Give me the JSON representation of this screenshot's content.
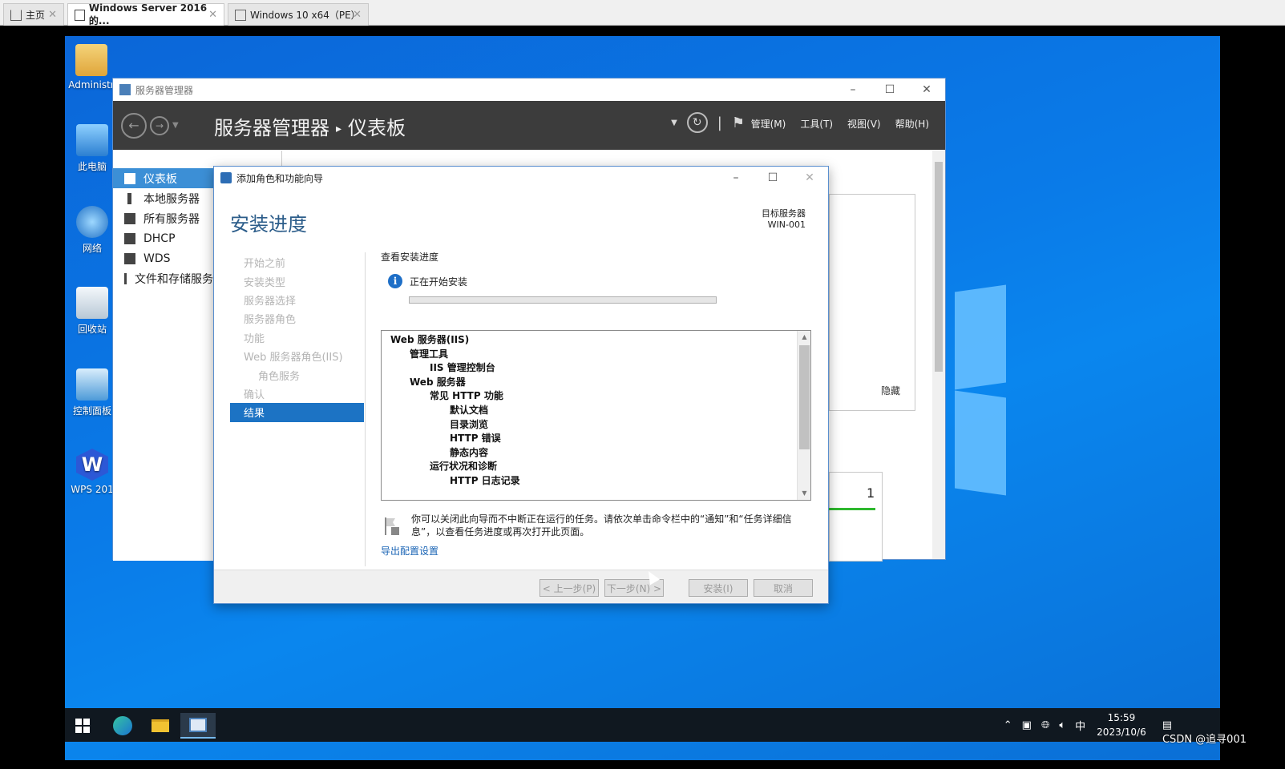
{
  "host_tabs": [
    {
      "label": "主页",
      "active": false
    },
    {
      "label": "Windows Server 2016 的...",
      "active": true
    },
    {
      "label": "Windows 10 x64（PE）",
      "active": false
    }
  ],
  "desktop": {
    "icons": [
      {
        "label": "Administr",
        "icon": "user-folder-icon"
      },
      {
        "label": "此电脑",
        "icon": "computer-icon"
      },
      {
        "label": "网络",
        "icon": "network-icon"
      },
      {
        "label": "回收站",
        "icon": "recycle-bin-icon"
      },
      {
        "label": "控制面板",
        "icon": "control-panel-icon"
      },
      {
        "label": "WPS 201",
        "icon": "wps-icon"
      }
    ]
  },
  "server_manager": {
    "window_title": "服务器管理器",
    "crumb_root": "服务器管理器",
    "crumb_page": "仪表板",
    "menus": [
      "管理(M)",
      "工具(T)",
      "视图(V)",
      "帮助(H)"
    ],
    "sidebar": [
      {
        "label": "仪表板",
        "active": true
      },
      {
        "label": "本地服务器",
        "active": false
      },
      {
        "label": "所有服务器",
        "active": false
      },
      {
        "label": "DHCP",
        "active": false
      },
      {
        "label": "WDS",
        "active": false
      },
      {
        "label": "文件和存储服务",
        "active": false
      }
    ],
    "hide_label": "隐藏",
    "tile_count": "1"
  },
  "wizard": {
    "title": "添加角色和功能向导",
    "heading": "安装进度",
    "target_label": "目标服务器",
    "target_name": "WIN-001",
    "steps": [
      {
        "label": "开始之前",
        "sub": false,
        "active": false
      },
      {
        "label": "安装类型",
        "sub": false,
        "active": false
      },
      {
        "label": "服务器选择",
        "sub": false,
        "active": false
      },
      {
        "label": "服务器角色",
        "sub": false,
        "active": false
      },
      {
        "label": "功能",
        "sub": false,
        "active": false
      },
      {
        "label": "Web 服务器角色(IIS)",
        "sub": false,
        "active": false
      },
      {
        "label": "角色服务",
        "sub": true,
        "active": false
      },
      {
        "label": "确认",
        "sub": false,
        "active": false
      },
      {
        "label": "结果",
        "sub": false,
        "active": true
      }
    ],
    "view_progress": "查看安装进度",
    "status_text": "正在开始安装",
    "progress_fraction": 0.0,
    "results": [
      {
        "label": "Web 服务器(IIS)",
        "level": 0
      },
      {
        "label": "管理工具",
        "level": 1
      },
      {
        "label": "IIS 管理控制台",
        "level": 2
      },
      {
        "label": "Web 服务器",
        "level": 1
      },
      {
        "label": "常见 HTTP 功能",
        "level": 2
      },
      {
        "label": "默认文档",
        "level": 3
      },
      {
        "label": "目录浏览",
        "level": 3
      },
      {
        "label": "HTTP 错误",
        "level": 3
      },
      {
        "label": "静态内容",
        "level": 3
      },
      {
        "label": "运行状况和诊断",
        "level": 2
      },
      {
        "label": "HTTP 日志记录",
        "level": 3
      }
    ],
    "notice": "你可以关闭此向导而不中断正在运行的任务。请依次单击命令栏中的“通知”和“任务详细信息”，以查看任务进度或再次打开此页面。",
    "export_link": "导出配置设置",
    "buttons": {
      "prev": "< 上一步(P)",
      "next": "下一步(N) >",
      "install": "安装(I)",
      "cancel": "取消"
    }
  },
  "taskbar": {
    "ime": "中",
    "time": "15:59",
    "date": "2023/10/6"
  },
  "watermark": "CSDN @追寻001"
}
